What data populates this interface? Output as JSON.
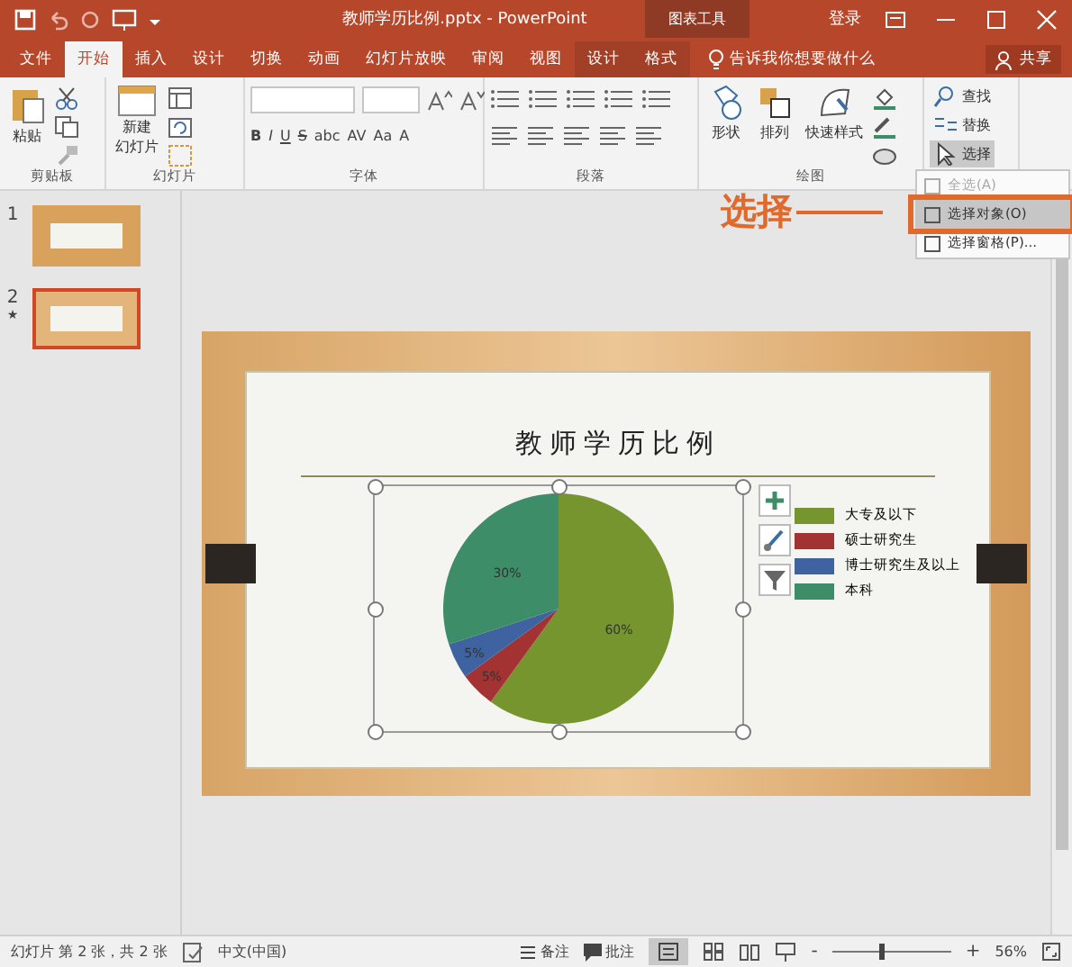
{
  "window": {
    "title": "教师学历比例.pptx - PowerPoint",
    "context_label": "图表工具",
    "sign_in": "登录"
  },
  "tabs": [
    {
      "label": "文件",
      "selected": false
    },
    {
      "label": "开始",
      "selected": true
    },
    {
      "label": "插入",
      "selected": false
    },
    {
      "label": "设计",
      "selected": false
    },
    {
      "label": "切换",
      "selected": false
    },
    {
      "label": "动画",
      "selected": false
    },
    {
      "label": "幻灯片放映",
      "selected": false
    },
    {
      "label": "审阅",
      "selected": false
    },
    {
      "label": "视图",
      "selected": false
    },
    {
      "label": "设计",
      "selected": false
    },
    {
      "label": "格式",
      "selected": false
    }
  ],
  "tell_me": "告诉我你想要做什么",
  "share": "共享",
  "ribbon": {
    "paste": "粘贴",
    "new_slide": [
      "新建",
      "幻灯片"
    ],
    "font_buttons": [
      "B",
      "I",
      "U",
      "S",
      "abc",
      "AV",
      "Aa",
      "A"
    ],
    "drawing_buttons": [
      "形状",
      "排列",
      "快速样式"
    ],
    "editing_buttons": [
      "查找",
      "替换",
      "选择"
    ],
    "group_labels": [
      "剪贴板",
      "幻灯片",
      "字体",
      "段落",
      "绘图"
    ]
  },
  "menu": {
    "items": [
      {
        "label": "全选(A)",
        "disabled": true,
        "selected": false
      },
      {
        "label": "选择对象(O)",
        "disabled": false,
        "selected": true
      },
      {
        "label": "选择窗格(P)...",
        "disabled": false,
        "selected": false
      }
    ]
  },
  "annotation": {
    "label": "选择"
  },
  "slides": [
    {
      "number": "1",
      "selected": false
    },
    {
      "number": "2",
      "selected": true,
      "mark": "★"
    }
  ],
  "slide": {
    "title": "教师学历比例",
    "chart_data": {
      "type": "pie",
      "categories": [
        "大专及以下",
        "硕士研究生",
        "博士研究生及以上",
        "本科"
      ],
      "series": [
        {
          "values": [
            60,
            5,
            5,
            30
          ]
        }
      ],
      "colors": [
        "#76952e",
        "#a33232",
        "#3f62a0",
        "#3c8d68"
      ],
      "value_labels": [
        "60%",
        "5%",
        "5%",
        "30%"
      ]
    }
  },
  "status_bar": {
    "slide_info": "幻灯片 第 2 张，共 2 张",
    "language": "中文(中国)",
    "notes": "备注",
    "comments": "批注",
    "zoom": "56%",
    "zoom_out": "-",
    "zoom_in": "+",
    "zoom_slider": {
      "level": 0.4
    }
  }
}
